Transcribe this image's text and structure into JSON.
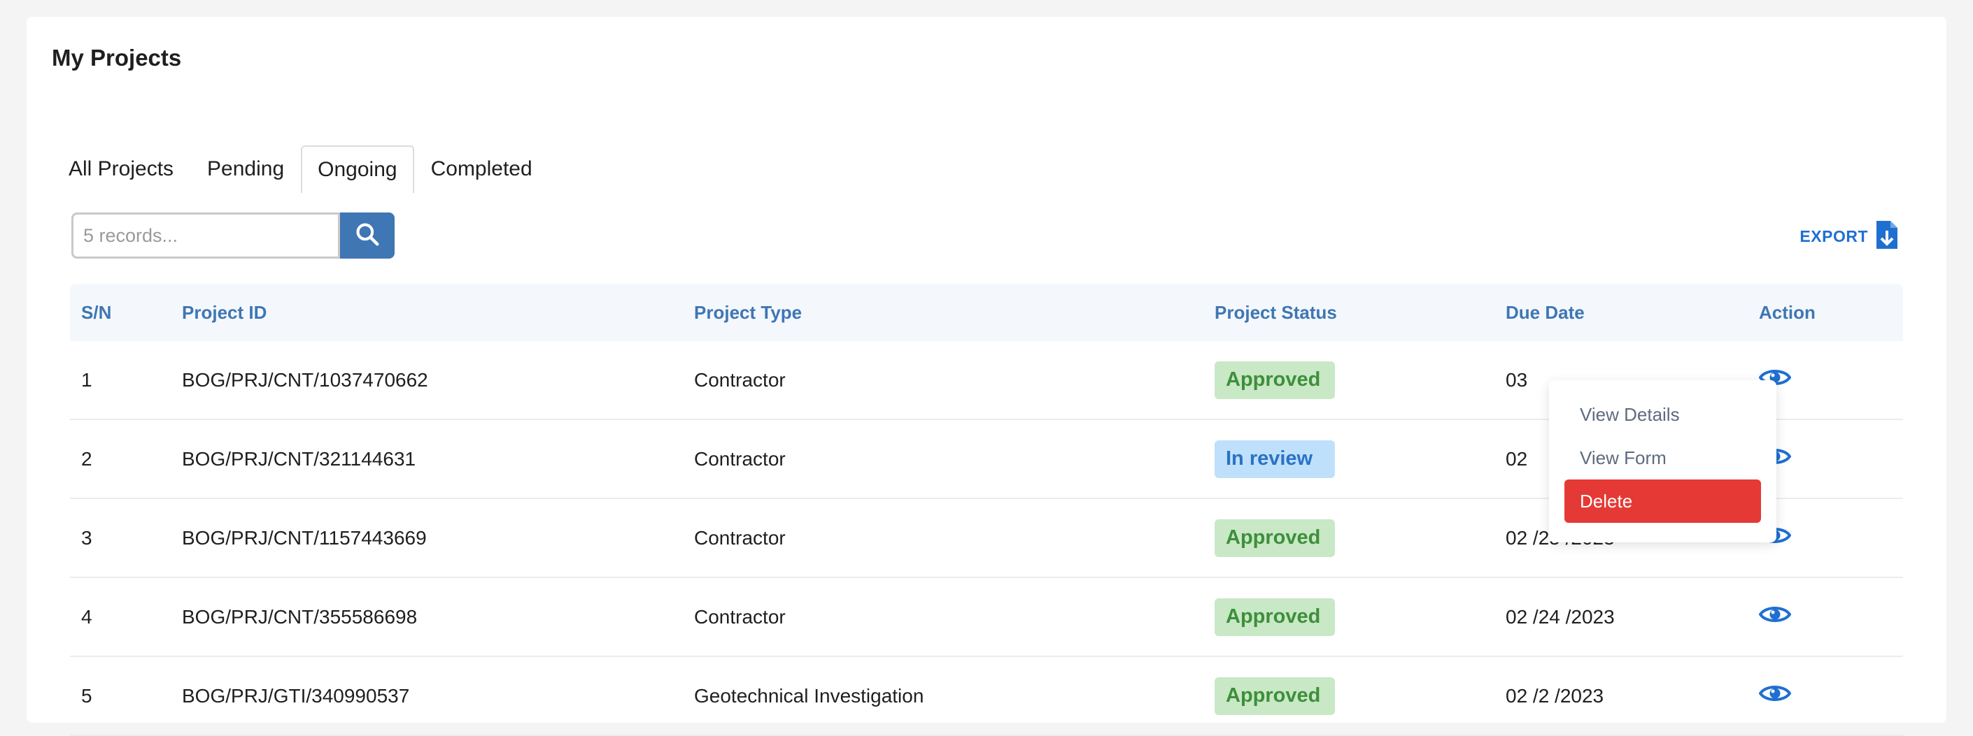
{
  "page": {
    "title": "My Projects"
  },
  "tabs": [
    {
      "label": "All Projects",
      "active": false
    },
    {
      "label": "Pending",
      "active": false
    },
    {
      "label": "Ongoing",
      "active": true
    },
    {
      "label": "Completed",
      "active": false
    }
  ],
  "search": {
    "placeholder": "5 records...",
    "value": "",
    "icon": "search-icon"
  },
  "export": {
    "label": "EXPORT",
    "icon": "file-download-icon"
  },
  "table": {
    "headers": [
      "S/N",
      "Project ID",
      "Project Type",
      "Project Status",
      "Due Date",
      "Action"
    ],
    "rows": [
      {
        "sn": "1",
        "id": "BOG/PRJ/CNT/1037470662",
        "type": "Contractor",
        "status": "Approved",
        "due": "03"
      },
      {
        "sn": "2",
        "id": "BOG/PRJ/CNT/321144631",
        "type": "Contractor",
        "status": "In review",
        "due": "02"
      },
      {
        "sn": "3",
        "id": "BOG/PRJ/CNT/1157443669",
        "type": "Contractor",
        "status": "Approved",
        "due": "02 /25 /2023"
      },
      {
        "sn": "4",
        "id": "BOG/PRJ/CNT/355586698",
        "type": "Contractor",
        "status": "Approved",
        "due": "02 /24 /2023"
      },
      {
        "sn": "5",
        "id": "BOG/PRJ/GTI/340990537",
        "type": "Geotechnical Investigation",
        "status": "Approved",
        "due": "02 /2 /2023"
      }
    ]
  },
  "action_menu": {
    "items": [
      "View Details",
      "View Form",
      "Delete"
    ]
  },
  "colors": {
    "accent": "#3f76b4",
    "approved_bg": "#c8e8c6",
    "approved_fg": "#3e8f3a",
    "review_bg": "#bfe0fb",
    "review_fg": "#2a72c4",
    "danger": "#e53935"
  }
}
